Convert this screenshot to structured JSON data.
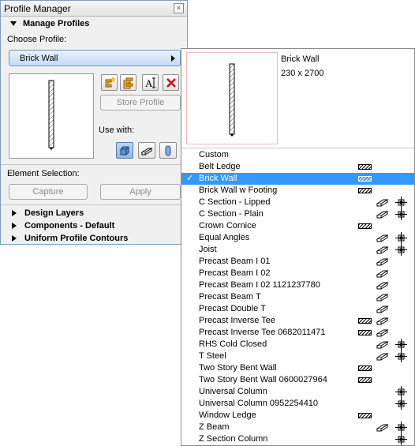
{
  "panel": {
    "title": "Profile Manager",
    "close_glyph": "×",
    "manage_heading": "Manage Profiles",
    "choose_label": "Choose Profile:",
    "selected_profile": "Brick Wall",
    "store_button": "Store Profile",
    "use_with_label": "Use with:",
    "element_selection_label": "Element Selection:",
    "capture_button": "Capture",
    "apply_button": "Apply",
    "sections": [
      "Design Layers",
      "Components - Default",
      "Uniform Profile Contours"
    ],
    "tool_icons": [
      "new-profile-icon",
      "duplicate-profile-icon",
      "rename-profile-icon",
      "delete-profile-icon"
    ],
    "use_with_icons": [
      "wall-tool-icon",
      "beam-tool-icon",
      "column-tool-icon"
    ]
  },
  "dropdown": {
    "preview_name": "Brick Wall",
    "preview_size": "230 x 2700",
    "check_glyph": "✓",
    "items": [
      {
        "label": "Custom",
        "wall": false,
        "beam": false,
        "column": false
      },
      {
        "label": "Belt Ledge",
        "wall": true,
        "beam": false,
        "column": false
      },
      {
        "label": "Brick Wall",
        "wall": true,
        "beam": false,
        "column": false,
        "selected": true
      },
      {
        "label": "Brick Wall w Footing",
        "wall": true,
        "beam": false,
        "column": false
      },
      {
        "label": "C Section - Lipped",
        "wall": false,
        "beam": true,
        "column": true
      },
      {
        "label": "C Section - Plain",
        "wall": false,
        "beam": true,
        "column": true
      },
      {
        "label": "Crown Cornice",
        "wall": true,
        "beam": false,
        "column": false
      },
      {
        "label": "Equal Angles",
        "wall": false,
        "beam": true,
        "column": true
      },
      {
        "label": "Joist",
        "wall": false,
        "beam": true,
        "column": true
      },
      {
        "label": "Precast Beam I 01",
        "wall": false,
        "beam": true,
        "column": false
      },
      {
        "label": "Precast Beam I 02",
        "wall": false,
        "beam": true,
        "column": false
      },
      {
        "label": "Precast Beam I 02 1121237780",
        "wall": false,
        "beam": true,
        "column": false
      },
      {
        "label": "Precast Beam T",
        "wall": false,
        "beam": true,
        "column": false
      },
      {
        "label": "Precast Double T",
        "wall": false,
        "beam": true,
        "column": false
      },
      {
        "label": "Precast Inverse Tee",
        "wall": true,
        "beam": true,
        "column": false
      },
      {
        "label": "Precast Inverse Tee 0682011471",
        "wall": true,
        "beam": true,
        "column": false
      },
      {
        "label": "RHS Cold Closed",
        "wall": false,
        "beam": true,
        "column": true
      },
      {
        "label": "T Steel",
        "wall": false,
        "beam": true,
        "column": true
      },
      {
        "label": "Two Story Bent Wall",
        "wall": true,
        "beam": false,
        "column": false
      },
      {
        "label": "Two Story Bent Wall 0600027964",
        "wall": true,
        "beam": false,
        "column": false
      },
      {
        "label": "Universal Column",
        "wall": false,
        "beam": false,
        "column": true
      },
      {
        "label": "Universal Column 0952254410",
        "wall": false,
        "beam": false,
        "column": true
      },
      {
        "label": "Window Ledge",
        "wall": true,
        "beam": false,
        "column": false
      },
      {
        "label": "Z Beam",
        "wall": false,
        "beam": true,
        "column": true
      },
      {
        "label": "Z Section Column",
        "wall": false,
        "beam": false,
        "column": true
      }
    ]
  },
  "colors": {
    "selection": "#3399ff",
    "select_fill": "#c5dcf4",
    "delete_red": "#d01010",
    "tool_orange": "#f0a020"
  }
}
